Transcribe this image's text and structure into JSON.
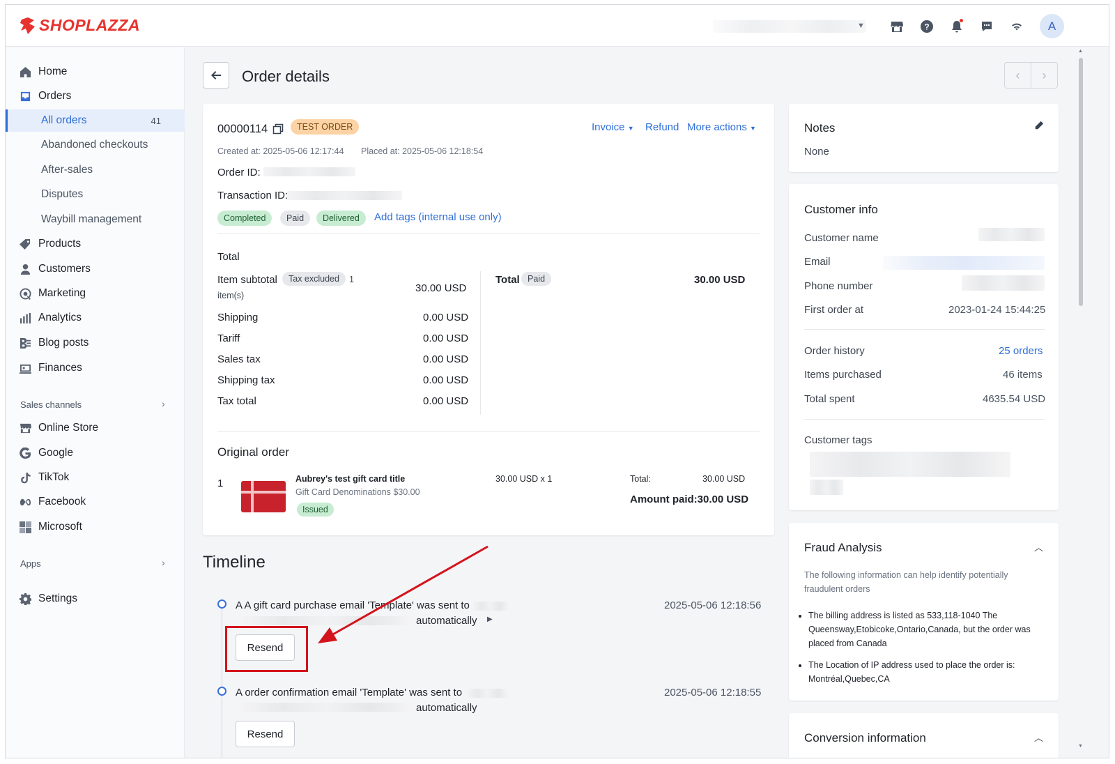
{
  "brand": {
    "name": "SHOPLAZZA",
    "accent": "#e8322d",
    "link_color": "#2f6fd6"
  },
  "topbar": {
    "icons": [
      "store-icon",
      "help-icon",
      "bell-icon",
      "chat-icon",
      "wifi-icon"
    ],
    "avatar_letter": "A"
  },
  "sidebar": {
    "items": [
      {
        "label": "Home",
        "icon": "home-icon"
      },
      {
        "label": "Orders",
        "icon": "orders-icon"
      },
      {
        "label": "Products",
        "icon": "tag-icon"
      },
      {
        "label": "Customers",
        "icon": "person-icon"
      },
      {
        "label": "Marketing",
        "icon": "marketing-icon"
      },
      {
        "label": "Analytics",
        "icon": "analytics-icon"
      },
      {
        "label": "Blog posts",
        "icon": "blog-icon"
      },
      {
        "label": "Finances",
        "icon": "finance-icon"
      }
    ],
    "order_sub": [
      {
        "label": "All orders",
        "count": "41"
      },
      {
        "label": "Abandoned checkouts"
      },
      {
        "label": "After-sales"
      },
      {
        "label": "Disputes"
      },
      {
        "label": "Waybill management"
      }
    ],
    "sales_channels_label": "Sales channels",
    "channels": [
      {
        "label": "Online Store",
        "icon": "store-icon"
      },
      {
        "label": "Google",
        "icon": "google-icon"
      },
      {
        "label": "TikTok",
        "icon": "tiktok-icon"
      },
      {
        "label": "Facebook",
        "icon": "meta-icon"
      },
      {
        "label": "Microsoft",
        "icon": "microsoft-icon"
      }
    ],
    "apps_label": "Apps",
    "settings_label": "Settings"
  },
  "page": {
    "title": "Order details"
  },
  "order": {
    "number": "00000114",
    "test_badge": "TEST ORDER",
    "actions": {
      "invoice": "Invoice",
      "refund": "Refund",
      "more": "More actions"
    },
    "created_label": "Created at:",
    "created_at": "2025-05-06 12:17:44",
    "placed_label": "Placed at:",
    "placed_at": "2025-05-06 12:18:54",
    "order_id_label": "Order ID:",
    "transaction_id_label": "Transaction ID:",
    "status_tags": [
      "Completed",
      "Paid",
      "Delivered"
    ],
    "add_tags": "Add tags (internal use only)"
  },
  "totals": {
    "heading": "Total",
    "item_subtotal_label": "Item subtotal",
    "tax_excluded": "Tax excluded",
    "items_count": "1",
    "items_unit": "item(s)",
    "item_subtotal_value": "30.00 USD",
    "rows": [
      {
        "label": "Shipping",
        "value": "0.00 USD"
      },
      {
        "label": "Tariff",
        "value": "0.00 USD"
      },
      {
        "label": "Sales tax",
        "value": "0.00 USD"
      },
      {
        "label": "Shipping tax",
        "value": "0.00 USD"
      },
      {
        "label": "Tax total",
        "value": "0.00 USD"
      }
    ],
    "total_label": "Total",
    "total_status": "Paid",
    "total_value": "30.00 USD"
  },
  "original_order": {
    "heading": "Original order",
    "line_no": "1",
    "product_title": "Aubrey's test gift card title",
    "variant": "Gift Card Denominations $30.00",
    "status": "Issued",
    "price_qty": "30.00 USD x 1",
    "total_label": "Total:",
    "total_value": "30.00 USD",
    "amount_paid": "Amount paid:30.00 USD"
  },
  "timeline": {
    "title": "Timeline",
    "events": [
      {
        "text": "A A gift card purchase email 'Template' was sent to",
        "suffix": "automatically",
        "time": "2025-05-06 12:18:56",
        "button": "Resend"
      },
      {
        "text": "A order confirmation email 'Template' was sent to",
        "suffix": "automatically",
        "time": "2025-05-06 12:18:55",
        "button": "Resend"
      }
    ]
  },
  "notes": {
    "title": "Notes",
    "value": "None"
  },
  "customer": {
    "title": "Customer info",
    "name_label": "Customer name",
    "email_label": "Email",
    "phone_label": "Phone number",
    "first_order_label": "First order at",
    "first_order_value": "2023-01-24 15:44:25",
    "order_history_label": "Order history",
    "order_history_value": "25 orders",
    "items_label": "Items purchased",
    "items_value": "46 items",
    "spent_label": "Total spent",
    "spent_value": "4635.54 USD",
    "tags_label": "Customer tags"
  },
  "fraud": {
    "title": "Fraud Analysis",
    "intro": "The following information can help identify potentially fraudulent orders",
    "points": [
      "The billing address is listed as 533,118-1040 The Queensway,Etobicoke,Ontario,Canada, but the order was placed from Canada",
      "The Location of IP address used to place the order is: Montréal,Quebec,CA"
    ]
  },
  "conversion": {
    "title": "Conversion information"
  },
  "annotation_color": "#d3141c"
}
